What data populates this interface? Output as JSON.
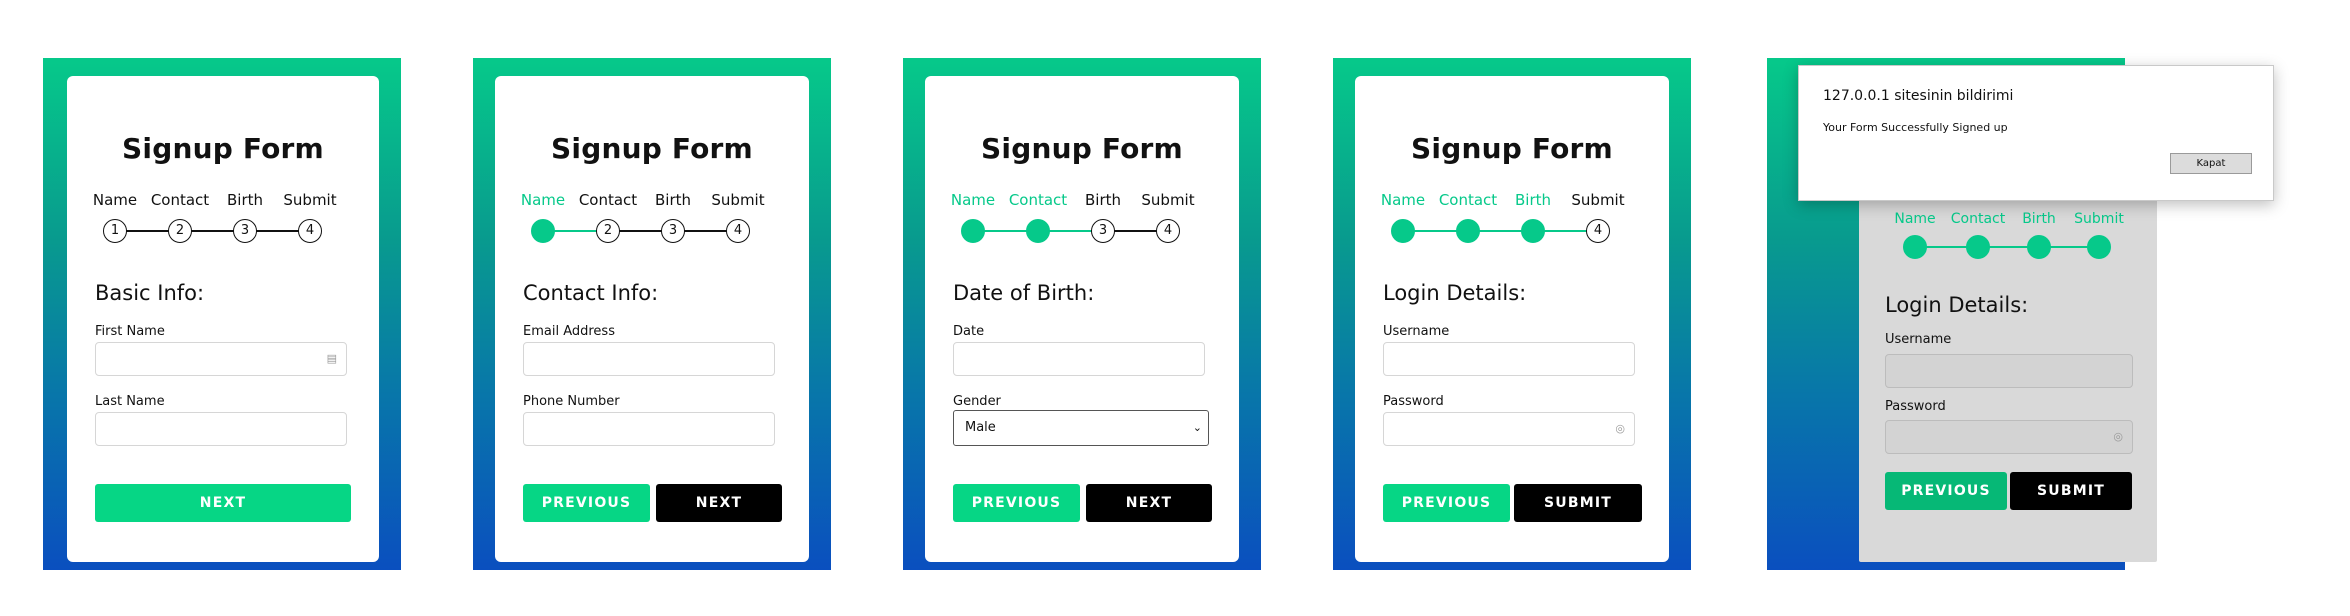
{
  "colors": {
    "accent": "#06c98a",
    "gradient_top": "#06c98a",
    "gradient_bottom": "#0a4fbf",
    "dark_button": "#000000"
  },
  "form_title": "Signup Form",
  "steps": [
    "Name",
    "Contact",
    "Birth",
    "Submit"
  ],
  "step_numbers": [
    "1",
    "2",
    "3",
    "4"
  ],
  "buttons": {
    "next": "NEXT",
    "previous": "PREVIOUS",
    "submit": "SUBMIT"
  },
  "panel1": {
    "section": "Basic Info:",
    "first_name_label": "First Name",
    "last_name_label": "Last Name",
    "first_name_value": "",
    "last_name_value": ""
  },
  "panel2": {
    "section": "Contact Info:",
    "email_label": "Email Address",
    "phone_label": "Phone Number",
    "email_value": "",
    "phone_value": ""
  },
  "panel3": {
    "section": "Date of Birth:",
    "date_label": "Date",
    "gender_label": "Gender",
    "gender_selected": "Male",
    "date_value": ""
  },
  "panel4": {
    "section": "Login Details:",
    "username_label": "Username",
    "password_label": "Password",
    "username_value": "",
    "password_value": ""
  },
  "panel5": {
    "section": "Login Details:",
    "username_label": "Username",
    "password_label": "Password"
  },
  "dialog": {
    "title": "127.0.0.1 sitesinin bildirimi",
    "message": "Your Form Successfully Signed up",
    "button": "Kapat"
  },
  "icons": {
    "field_icon": "list-icon",
    "password_icon": "key-icon",
    "select_icon": "chevron-down-icon"
  }
}
